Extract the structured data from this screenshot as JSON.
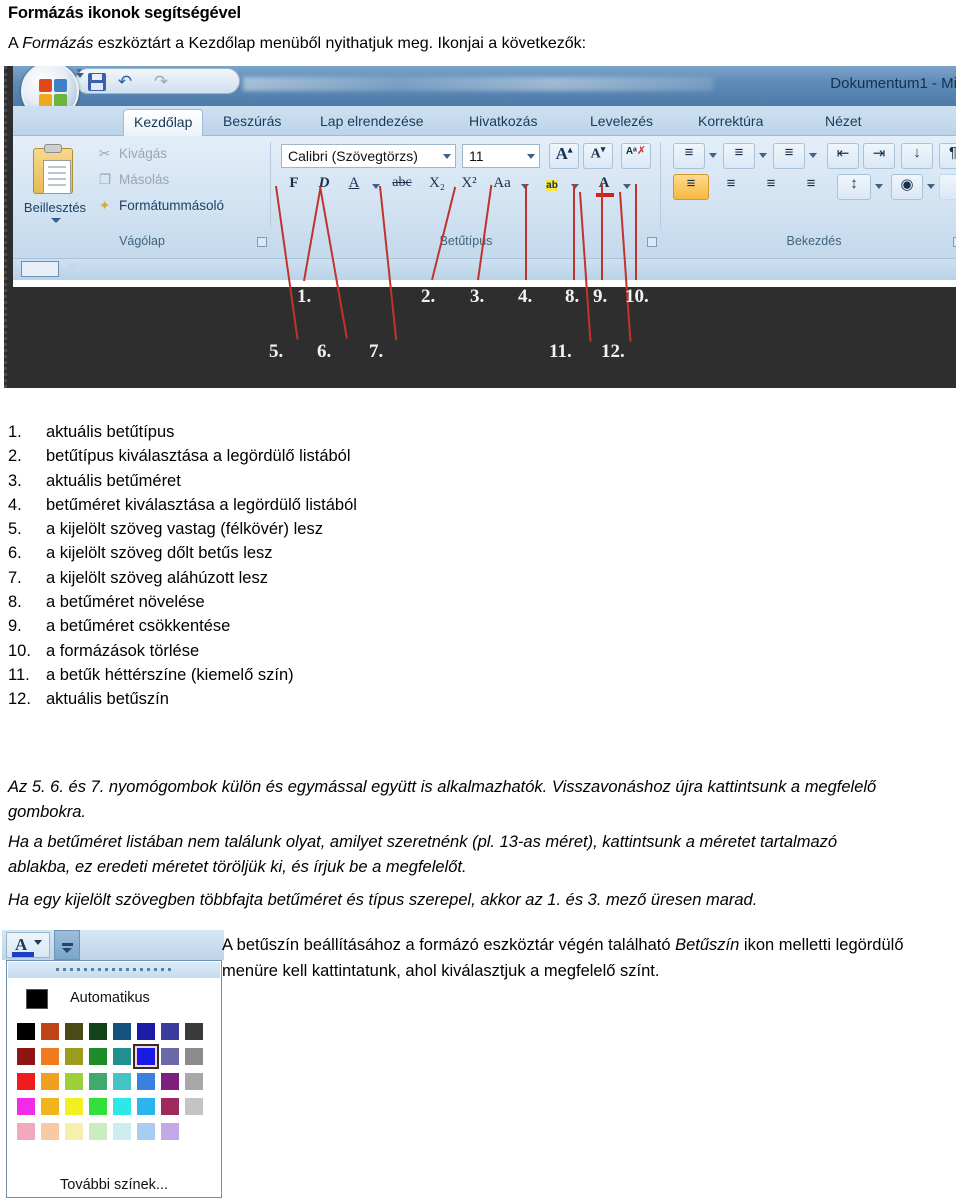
{
  "document": {
    "title": "Formázás ikonok segítségével",
    "intro_before": "A ",
    "intro_italic": "Formázás",
    "intro_after": " eszköztárt a Kezdőlap menüből nyithatjuk meg. Ikonjai a következők:"
  },
  "screenshot": {
    "titlebar": {
      "document_name": "Dokumentum1 - Mi"
    },
    "quick_access": {
      "save": "save-icon",
      "undo": "undo-icon",
      "redo": "redo-icon"
    },
    "tabs": [
      {
        "label": "Kezdőlap",
        "active": true
      },
      {
        "label": "Beszúrás",
        "active": false
      },
      {
        "label": "Lap elrendezése",
        "active": false
      },
      {
        "label": "Hivatkozás",
        "active": false
      },
      {
        "label": "Levelezés",
        "active": false
      },
      {
        "label": "Korrektúra",
        "active": false
      },
      {
        "label": "Nézet",
        "active": false
      }
    ],
    "groups": {
      "clipboard": {
        "label": "Vágólap",
        "paste": "Beillesztés",
        "cut": "Kivágás",
        "copy": "Másolás",
        "format_painter": "Formátummásoló"
      },
      "font": {
        "label": "Betűtípus",
        "font_name_value": "Calibri (Szövegtörzs)",
        "font_size_value": "11",
        "bold": "F",
        "italic": "D",
        "underline": "A",
        "strikethrough": "abc",
        "subscript": "X₂",
        "superscript": "X²",
        "change_case": "Aa",
        "highlight": "ab",
        "font_color": "A"
      },
      "paragraph": {
        "label": "Bekezdés"
      }
    },
    "callouts_row1": [
      "1.",
      "2.",
      "3.",
      "4.",
      "8.",
      "9.",
      "10."
    ],
    "callouts_row2": [
      "5.",
      "6.",
      "7.",
      "11.",
      "12."
    ]
  },
  "legend": [
    {
      "n": "1.",
      "text": "aktuális betűtípus"
    },
    {
      "n": "2.",
      "text": "betűtípus kiválasztása a legördülő listából"
    },
    {
      "n": "3.",
      "text": "aktuális betűméret"
    },
    {
      "n": "4.",
      "text": "betűméret kiválasztása a legördülő listából"
    },
    {
      "n": "5.",
      "text": "a kijelölt szöveg vastag (félkövér) lesz"
    },
    {
      "n": "6.",
      "text": "a kijelölt szöveg dőlt betűs lesz"
    },
    {
      "n": "7.",
      "text": "a kijelölt szöveg aláhúzott lesz"
    },
    {
      "n": "8.",
      "text": "a betűméret növelése"
    },
    {
      "n": "9.",
      "text": "a betűméret csökkentése"
    },
    {
      "n": "10.",
      "text": "a formázások törlése"
    },
    {
      "n": "11.",
      "text": "a betűk héttérszíne (kiemelő szín)"
    },
    {
      "n": "12.",
      "text": "aktuális betűszín"
    }
  ],
  "notes": {
    "p1": "Az 5. 6. és 7. nyomógombok külön és egymással együtt is alkalmazhatók. Visszavonáshoz újra kattintsunk a megfelelő gombokra.",
    "p2": "Ha a betűméret listában nem találunk olyat, amilyet szeretnénk (pl. 13-as méret), kattintsunk a méretet tartalmazó ablakba, ez eredeti méretet töröljük ki, és írjuk be a megfelelőt.",
    "p3": "Ha egy kijelölt szövegben többfajta betűméret és típus szerepel, akkor az 1. és 3. mező üresen marad."
  },
  "color_picker": {
    "automatic_label": "Automatikus",
    "more_colors_label": "További színek...",
    "automatic_swatch": "#000000",
    "selected_color": "#1a1ae6",
    "selected_index": {
      "row": 1,
      "col": 5
    },
    "grid": [
      [
        "#000000",
        "#bf4417",
        "#4a4a16",
        "#12421a",
        "#13517e",
        "#1c1ca8",
        "#3c3c9e",
        "#3a3a3a"
      ],
      [
        "#8f1414",
        "#f07a1e",
        "#9c9c1f",
        "#1e8b2a",
        "#1f8f8f",
        "#1a1ae6",
        "#6a6aa8",
        "#8c8c8c"
      ],
      [
        "#ee1c1c",
        "#f0a020",
        "#9ccf3a",
        "#41a86e",
        "#45c3c3",
        "#3b7fe0",
        "#7d1f7d",
        "#a8a8a8"
      ],
      [
        "#f02ce8",
        "#f0b41e",
        "#f2f024",
        "#33e03a",
        "#2ee8e8",
        "#2bb4ee",
        "#9e2a5c",
        "#c4c4c4"
      ],
      [
        "#f2a8bd",
        "#f7caa4",
        "#f7efb0",
        "#c9ecc0",
        "#cdecef",
        "#a9cdef",
        "#c4a9e8",
        "#ffffff"
      ]
    ],
    "side_text_before": "A betűszín beállításához a formázó eszköztár végén található ",
    "side_text_italic": "Betűszín",
    "side_text_after": " ikon melletti legördülő menüre kell kattintatunk, ahol  kiválasztjuk a megfelelő színt."
  }
}
